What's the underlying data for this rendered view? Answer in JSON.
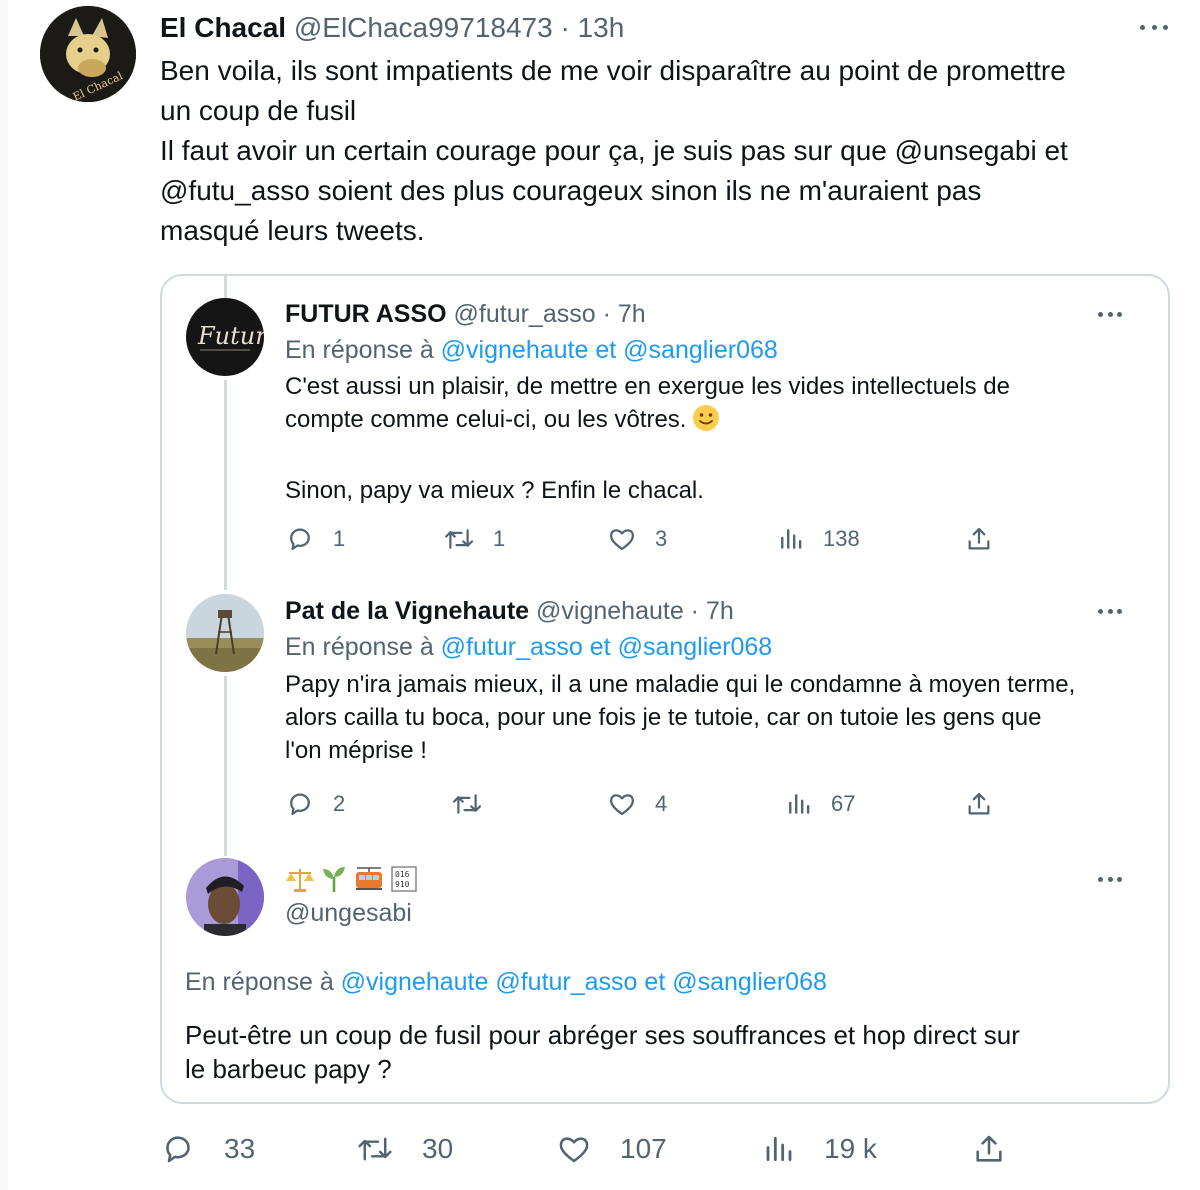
{
  "main_tweet": {
    "author_name": "El Chacal",
    "author_handle": "@ElChaca99718473",
    "time": "13h",
    "separator": " · ",
    "text_lines": [
      "Ben voila, ils sont impatients de me voir disparaître au point de promettre",
      "un coup de fusil",
      "Il faut avoir un certain courage pour ça, je suis pas sur que @unsegabi et",
      "@futu_asso soient des plus courageux sinon ils ne m'auraient pas",
      "masqué leurs tweets."
    ],
    "stats": {
      "replies": "33",
      "retweets": "30",
      "likes": "107",
      "views": "19 k"
    }
  },
  "quoted_thread": [
    {
      "author_name": "FUTUR ASSO",
      "author_handle": "@futur_asso",
      "time": "7h",
      "reply_prefix": "En réponse à",
      "reply_to": [
        "@vignehaute",
        "@sanglier068"
      ],
      "reply_joiner": "et",
      "text_lines": [
        "C'est aussi un plaisir, de mettre en exergue les vides intellectuels de",
        "compte comme celui-ci, ou les vôtres.",
        "",
        "Sinon, papy va mieux ? Enfin le chacal."
      ],
      "stats": {
        "replies": "1",
        "retweets": "1",
        "likes": "3",
        "views": "138"
      }
    },
    {
      "author_name": "Pat de la Vignehaute",
      "author_handle": "@vignehaute",
      "time": "7h",
      "reply_prefix": "En réponse à",
      "reply_to": [
        "@futur_asso",
        "@sanglier068"
      ],
      "reply_joiner": "et",
      "text_lines": [
        "Papy n'ira jamais mieux, il a une maladie qui le condamne à moyen terme,",
        "alors cailla tu boca, pour une fois je te tutoie, car on tutoie les gens que",
        "l'on méprise !"
      ],
      "stats": {
        "replies": "2",
        "retweets": "",
        "likes": "4",
        "views": "67"
      }
    },
    {
      "author_name_icons": [
        "balance-scale-emoji",
        "seedling-emoji",
        "tram-emoji",
        "binary-emoji"
      ],
      "author_handle": "@ungesabi",
      "reply_prefix": "En réponse à",
      "reply_to": [
        "@vignehaute",
        "@futur_asso",
        "@sanglier068"
      ],
      "reply_joiner": "et",
      "text_lines": [
        "Peut-être un coup de fusil pour abréger ses souffrances et hop direct sur",
        "le barbeuc papy ?"
      ]
    }
  ],
  "colors": {
    "link": "#1d9bf0",
    "secondary_text": "#536471",
    "border": "#cfd9de",
    "primary_text": "#0f1419"
  },
  "icons": {
    "reply": "reply-icon",
    "retweet": "retweet-icon",
    "like": "heart-icon",
    "views": "views-icon",
    "share": "share-icon",
    "more": "more-dots-icon"
  }
}
